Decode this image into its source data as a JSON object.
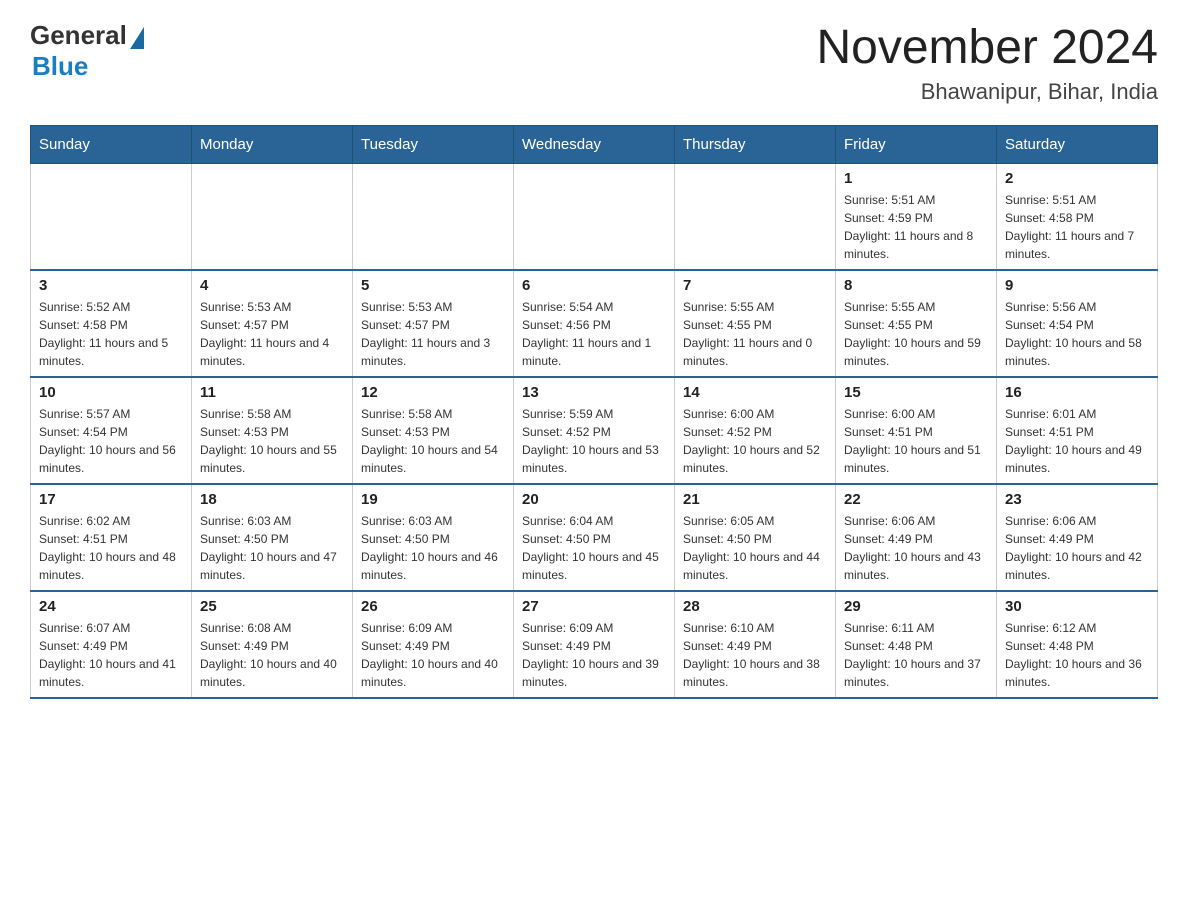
{
  "logo": {
    "general_text": "General",
    "blue_text": "Blue"
  },
  "title": "November 2024",
  "subtitle": "Bhawanipur, Bihar, India",
  "days_of_week": [
    "Sunday",
    "Monday",
    "Tuesday",
    "Wednesday",
    "Thursday",
    "Friday",
    "Saturday"
  ],
  "weeks": [
    [
      {
        "day": "",
        "info": ""
      },
      {
        "day": "",
        "info": ""
      },
      {
        "day": "",
        "info": ""
      },
      {
        "day": "",
        "info": ""
      },
      {
        "day": "",
        "info": ""
      },
      {
        "day": "1",
        "info": "Sunrise: 5:51 AM\nSunset: 4:59 PM\nDaylight: 11 hours and 8 minutes."
      },
      {
        "day": "2",
        "info": "Sunrise: 5:51 AM\nSunset: 4:58 PM\nDaylight: 11 hours and 7 minutes."
      }
    ],
    [
      {
        "day": "3",
        "info": "Sunrise: 5:52 AM\nSunset: 4:58 PM\nDaylight: 11 hours and 5 minutes."
      },
      {
        "day": "4",
        "info": "Sunrise: 5:53 AM\nSunset: 4:57 PM\nDaylight: 11 hours and 4 minutes."
      },
      {
        "day": "5",
        "info": "Sunrise: 5:53 AM\nSunset: 4:57 PM\nDaylight: 11 hours and 3 minutes."
      },
      {
        "day": "6",
        "info": "Sunrise: 5:54 AM\nSunset: 4:56 PM\nDaylight: 11 hours and 1 minute."
      },
      {
        "day": "7",
        "info": "Sunrise: 5:55 AM\nSunset: 4:55 PM\nDaylight: 11 hours and 0 minutes."
      },
      {
        "day": "8",
        "info": "Sunrise: 5:55 AM\nSunset: 4:55 PM\nDaylight: 10 hours and 59 minutes."
      },
      {
        "day": "9",
        "info": "Sunrise: 5:56 AM\nSunset: 4:54 PM\nDaylight: 10 hours and 58 minutes."
      }
    ],
    [
      {
        "day": "10",
        "info": "Sunrise: 5:57 AM\nSunset: 4:54 PM\nDaylight: 10 hours and 56 minutes."
      },
      {
        "day": "11",
        "info": "Sunrise: 5:58 AM\nSunset: 4:53 PM\nDaylight: 10 hours and 55 minutes."
      },
      {
        "day": "12",
        "info": "Sunrise: 5:58 AM\nSunset: 4:53 PM\nDaylight: 10 hours and 54 minutes."
      },
      {
        "day": "13",
        "info": "Sunrise: 5:59 AM\nSunset: 4:52 PM\nDaylight: 10 hours and 53 minutes."
      },
      {
        "day": "14",
        "info": "Sunrise: 6:00 AM\nSunset: 4:52 PM\nDaylight: 10 hours and 52 minutes."
      },
      {
        "day": "15",
        "info": "Sunrise: 6:00 AM\nSunset: 4:51 PM\nDaylight: 10 hours and 51 minutes."
      },
      {
        "day": "16",
        "info": "Sunrise: 6:01 AM\nSunset: 4:51 PM\nDaylight: 10 hours and 49 minutes."
      }
    ],
    [
      {
        "day": "17",
        "info": "Sunrise: 6:02 AM\nSunset: 4:51 PM\nDaylight: 10 hours and 48 minutes."
      },
      {
        "day": "18",
        "info": "Sunrise: 6:03 AM\nSunset: 4:50 PM\nDaylight: 10 hours and 47 minutes."
      },
      {
        "day": "19",
        "info": "Sunrise: 6:03 AM\nSunset: 4:50 PM\nDaylight: 10 hours and 46 minutes."
      },
      {
        "day": "20",
        "info": "Sunrise: 6:04 AM\nSunset: 4:50 PM\nDaylight: 10 hours and 45 minutes."
      },
      {
        "day": "21",
        "info": "Sunrise: 6:05 AM\nSunset: 4:50 PM\nDaylight: 10 hours and 44 minutes."
      },
      {
        "day": "22",
        "info": "Sunrise: 6:06 AM\nSunset: 4:49 PM\nDaylight: 10 hours and 43 minutes."
      },
      {
        "day": "23",
        "info": "Sunrise: 6:06 AM\nSunset: 4:49 PM\nDaylight: 10 hours and 42 minutes."
      }
    ],
    [
      {
        "day": "24",
        "info": "Sunrise: 6:07 AM\nSunset: 4:49 PM\nDaylight: 10 hours and 41 minutes."
      },
      {
        "day": "25",
        "info": "Sunrise: 6:08 AM\nSunset: 4:49 PM\nDaylight: 10 hours and 40 minutes."
      },
      {
        "day": "26",
        "info": "Sunrise: 6:09 AM\nSunset: 4:49 PM\nDaylight: 10 hours and 40 minutes."
      },
      {
        "day": "27",
        "info": "Sunrise: 6:09 AM\nSunset: 4:49 PM\nDaylight: 10 hours and 39 minutes."
      },
      {
        "day": "28",
        "info": "Sunrise: 6:10 AM\nSunset: 4:49 PM\nDaylight: 10 hours and 38 minutes."
      },
      {
        "day": "29",
        "info": "Sunrise: 6:11 AM\nSunset: 4:48 PM\nDaylight: 10 hours and 37 minutes."
      },
      {
        "day": "30",
        "info": "Sunrise: 6:12 AM\nSunset: 4:48 PM\nDaylight: 10 hours and 36 minutes."
      }
    ]
  ]
}
